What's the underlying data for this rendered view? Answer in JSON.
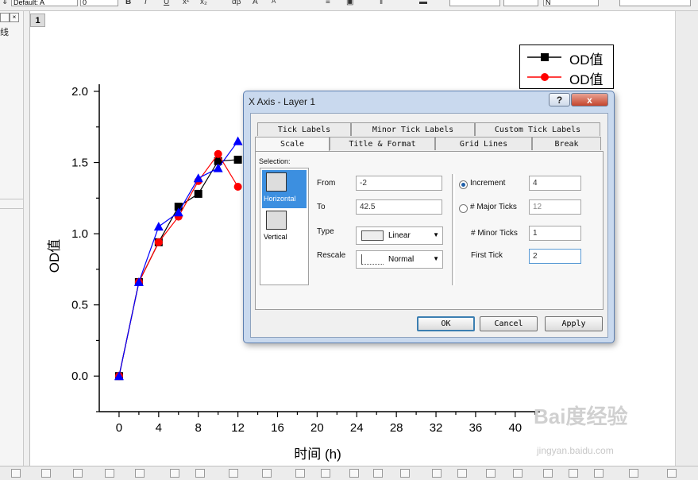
{
  "toolbar": {
    "font_name": "Default: A",
    "font_size": "0",
    "bold": "B",
    "italic": "I",
    "underline": "U",
    "ops": [
      "x²",
      "x₂",
      "αβ",
      "A",
      "A"
    ],
    "right_field": "N"
  },
  "left_panel": {
    "label": "线",
    "close": "×"
  },
  "page": {
    "layer_number": "1"
  },
  "chart_data": {
    "type": "line",
    "x": [
      0,
      2,
      4,
      6,
      8,
      10,
      12
    ],
    "series": [
      {
        "name": "OD值",
        "marker": "square",
        "color": "#000000",
        "values": [
          0.0,
          0.66,
          0.94,
          1.19,
          1.28,
          1.51,
          1.52
        ]
      },
      {
        "name": "OD值",
        "marker": "circle",
        "color": "#ff0000",
        "values": [
          0.0,
          0.66,
          0.94,
          1.12,
          1.37,
          1.56,
          1.33
        ]
      },
      {
        "marker": "triangle",
        "color": "#0000ff",
        "values": [
          0.0,
          0.66,
          1.05,
          1.15,
          1.39,
          1.46,
          1.65
        ]
      }
    ],
    "xlabel": "时间 (h)",
    "ylabel": "OD值",
    "xlim": [
      -2,
      42.5
    ],
    "ylim": [
      -0.25,
      2.05
    ],
    "xticks": [
      "0",
      "4",
      "8",
      "12",
      "16",
      "20",
      "24",
      "28",
      "32",
      "36",
      "40"
    ],
    "yticks": [
      "0.0",
      "0.5",
      "1.0",
      "1.5",
      "2.0"
    ],
    "grid": false,
    "legend_placement": "top-right"
  },
  "legend": {
    "entries": [
      "OD值",
      "OD值"
    ]
  },
  "dialog": {
    "title": "X Axis - Layer 1",
    "help": "?",
    "close": "x",
    "tabs_back": [
      "Tick Labels",
      "Minor Tick Labels",
      "Custom Tick Labels"
    ],
    "tabs_front": [
      "Scale",
      "Title & Format",
      "Grid Lines",
      "Break"
    ],
    "selection_label": "Selection:",
    "selection_items": [
      "Horizontal",
      "Vertical"
    ],
    "from_label": "From",
    "from_value": "-2",
    "to_label": "To",
    "to_value": "42.5",
    "type_label": "Type",
    "type_value": "Linear",
    "rescale_label": "Rescale",
    "rescale_value": "Normal",
    "increment_label": "Increment",
    "increment_value": "4",
    "major_ticks_label": "# Major Ticks",
    "major_ticks_value": "12",
    "minor_ticks_label": "# Minor Ticks",
    "minor_ticks_value": "1",
    "first_tick_label": "First Tick",
    "first_tick_value": "2",
    "ok": "OK",
    "cancel": "Cancel",
    "apply": "Apply"
  },
  "watermark": {
    "main": "Bai度经验",
    "sub": "jingyan.baidu.com"
  },
  "colors": {
    "dialog_frame": "#c9d9ee",
    "selection": "#3c8fe0",
    "annotation_arrow": "#e0463a"
  }
}
